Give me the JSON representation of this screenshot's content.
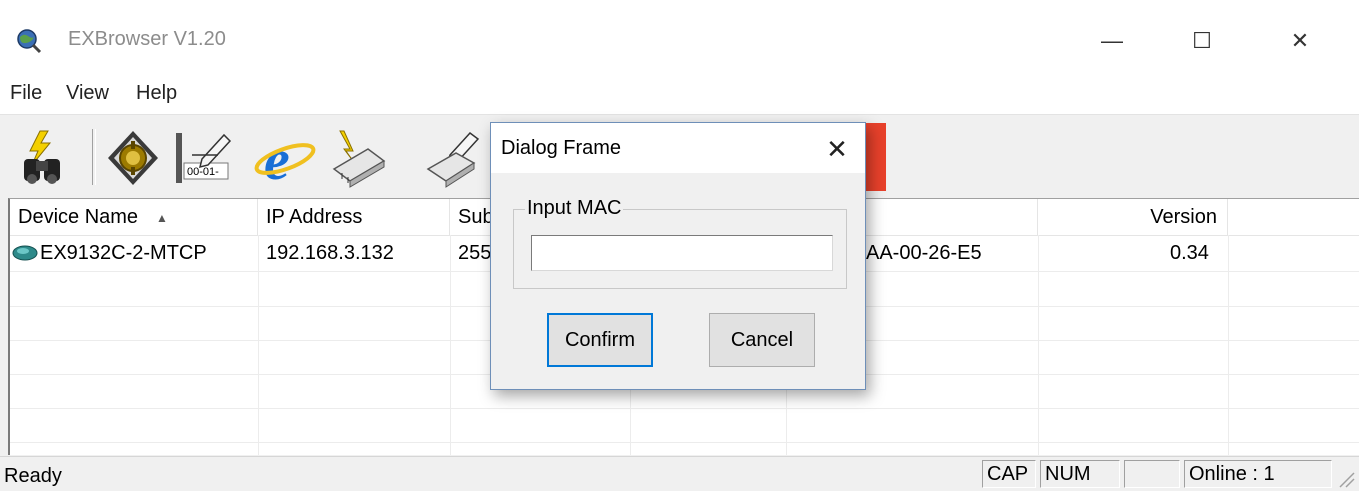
{
  "window": {
    "title": "EXBrowser V1.20",
    "min_glyph": "—",
    "max_glyph": "☐",
    "close_glyph": "✕"
  },
  "menu": {
    "items": [
      {
        "label": "File"
      },
      {
        "label": "View"
      },
      {
        "label": "Help"
      }
    ]
  },
  "toolbar": {
    "tools": [
      {
        "icon": "search-devices-icon"
      },
      {
        "icon": "settings-gear-icon"
      },
      {
        "icon": "edit-mac-icon",
        "text": "00-01-"
      },
      {
        "icon": "internet-explorer-icon",
        "text": "e"
      },
      {
        "icon": "firmware-flash-icon"
      },
      {
        "icon": "write-chip-icon"
      }
    ]
  },
  "list": {
    "columns": [
      {
        "label": "Device Name"
      },
      {
        "label": "IP Address"
      },
      {
        "label": "Sub"
      },
      {
        "label": ""
      },
      {
        "label": ""
      },
      {
        "label": "Version"
      },
      {
        "label": ""
      }
    ],
    "rows": [
      {
        "device": "EX9132C-2-MTCP",
        "ip": "192.168.3.132",
        "subnet": "255",
        "mac": "AA-00-26-E5",
        "version": "0.34"
      }
    ]
  },
  "status": {
    "text": "Ready",
    "cap": "CAP",
    "num": "NUM",
    "scrl": "",
    "online": "Online : 1"
  },
  "dialog": {
    "title": "Dialog Frame",
    "close_glyph": "✕",
    "group_label": "Input MAC",
    "mac_value": "",
    "confirm_label": "Confirm",
    "cancel_label": "Cancel"
  },
  "colors": {
    "accent": "#0078d7",
    "toolbar_red": "#e8412b",
    "window_bg": "#f0f0f0"
  }
}
